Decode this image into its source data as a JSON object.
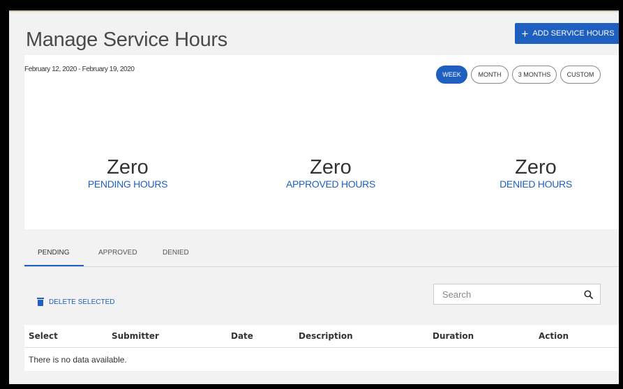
{
  "page": {
    "title": "Manage Service Hours"
  },
  "toolbar": {
    "add_label": "ADD SERVICE HOURS",
    "add_icon": "plus-icon"
  },
  "summary": {
    "date_range": "February 12, 2020 - February 19, 2020",
    "periods": [
      "WEEK",
      "MONTH",
      "3 MONTHS",
      "CUSTOM"
    ],
    "active_period": "WEEK",
    "stats": [
      {
        "value": "Zero",
        "label": "PENDING HOURS"
      },
      {
        "value": "Zero",
        "label": "APPROVED HOURS"
      },
      {
        "value": "Zero",
        "label": "DENIED HOURS"
      }
    ]
  },
  "tabs": [
    "PENDING",
    "APPROVED",
    "DENIED"
  ],
  "actions": {
    "delete_label": "DELETE SELECTED",
    "delete_icon": "trash-icon"
  },
  "search": {
    "placeholder": "Search",
    "icon": "search-icon"
  },
  "table": {
    "headers": [
      "Select",
      "Submitter",
      "Date",
      "Description",
      "Duration",
      "Action"
    ],
    "empty_message": "There is no data available."
  },
  "colors": {
    "accent": "#1f5fbf",
    "background": "#f2f2f2"
  }
}
